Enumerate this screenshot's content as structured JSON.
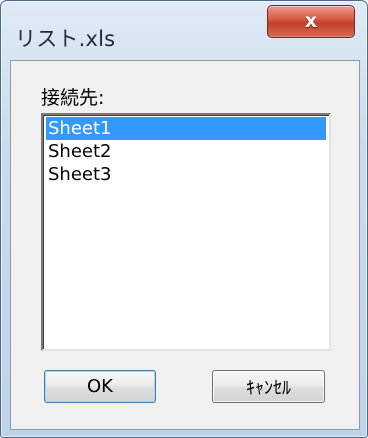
{
  "window": {
    "title": "リスト.xls",
    "close_glyph": "x",
    "close_icon": "close-icon"
  },
  "dialog": {
    "connect_label": "接続先:",
    "list_items": [
      {
        "label": "Sheet1",
        "selected": true
      },
      {
        "label": "Sheet2",
        "selected": false
      },
      {
        "label": "Sheet3",
        "selected": false
      }
    ],
    "ok_label": "OK",
    "cancel_label": "ｷｬﾝｾﾙ"
  },
  "colors": {
    "selection": "#3399ff",
    "close_button": "#c23f29"
  }
}
